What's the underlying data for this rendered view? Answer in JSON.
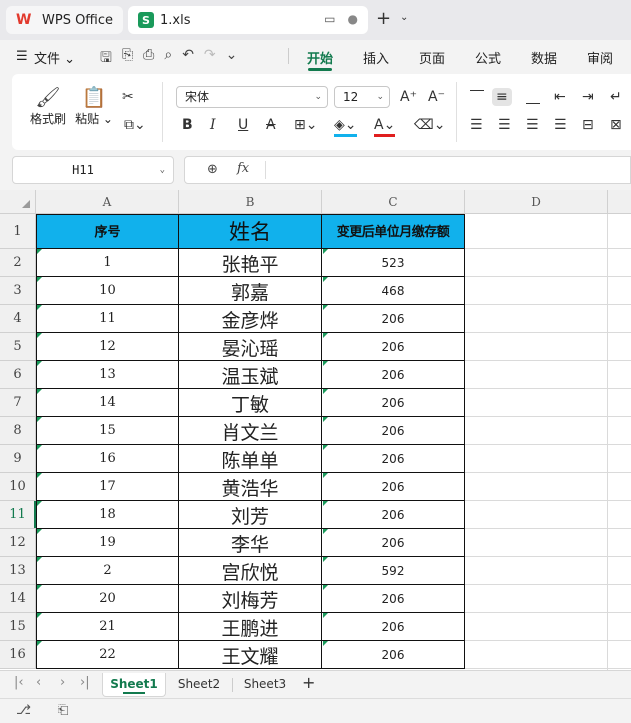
{
  "titlebar": {
    "app_tab": "WPS Office",
    "file_tab": "1.xls",
    "file_badge": "S",
    "new_tab": "+",
    "tab_menu": "⌄"
  },
  "menubar": {
    "file": "文件 ⌄",
    "tabs": [
      "开始",
      "插入",
      "页面",
      "公式",
      "数据",
      "审阅"
    ],
    "active_tab": "开始"
  },
  "ribbon": {
    "format_painter": "格式刷",
    "paste": "粘贴",
    "paste_dd": "粘贴 ⌄",
    "font_name": "宋体",
    "font_size": "12",
    "bold": "B",
    "italic": "I",
    "underline": "U",
    "strike": "A"
  },
  "formula_bar": {
    "cell_ref": "H11",
    "fx": "fx",
    "formula": ""
  },
  "columns": [
    "A",
    "B",
    "C",
    "D"
  ],
  "header_row": {
    "a": "序号",
    "b": "姓名",
    "c": "变更后单位月缴存额"
  },
  "rows": [
    {
      "n": "2",
      "a": "1",
      "b": "张艳平",
      "c": "523"
    },
    {
      "n": "3",
      "a": "10",
      "b": "郭嘉",
      "c": "468"
    },
    {
      "n": "4",
      "a": "11",
      "b": "金彦烨",
      "c": "206"
    },
    {
      "n": "5",
      "a": "12",
      "b": "晏沁瑶",
      "c": "206"
    },
    {
      "n": "6",
      "a": "13",
      "b": "温玉斌",
      "c": "206"
    },
    {
      "n": "7",
      "a": "14",
      "b": "丁敏",
      "c": "206"
    },
    {
      "n": "8",
      "a": "15",
      "b": "肖文兰",
      "c": "206"
    },
    {
      "n": "9",
      "a": "16",
      "b": "陈单单",
      "c": "206"
    },
    {
      "n": "10",
      "a": "17",
      "b": "黄浩华",
      "c": "206"
    },
    {
      "n": "11",
      "a": "18",
      "b": "刘芳",
      "c": "206"
    },
    {
      "n": "12",
      "a": "19",
      "b": "李华",
      "c": "206"
    },
    {
      "n": "13",
      "a": "2",
      "b": "宫欣悦",
      "c": "592"
    },
    {
      "n": "14",
      "a": "20",
      "b": "刘梅芳",
      "c": "206"
    },
    {
      "n": "15",
      "a": "21",
      "b": "王鹏进",
      "c": "206"
    },
    {
      "n": "16",
      "a": "22",
      "b": "王文耀",
      "c": "206"
    }
  ],
  "row_one_label": "1",
  "active_row": "11",
  "sheets": [
    "Sheet1",
    "Sheet2",
    "Sheet3"
  ],
  "active_sheet": "Sheet1",
  "add_sheet": "+",
  "colors": {
    "header_fill": "#11b1ec",
    "accent": "#127a4e",
    "sheet_icon": "#1a9a5b"
  }
}
